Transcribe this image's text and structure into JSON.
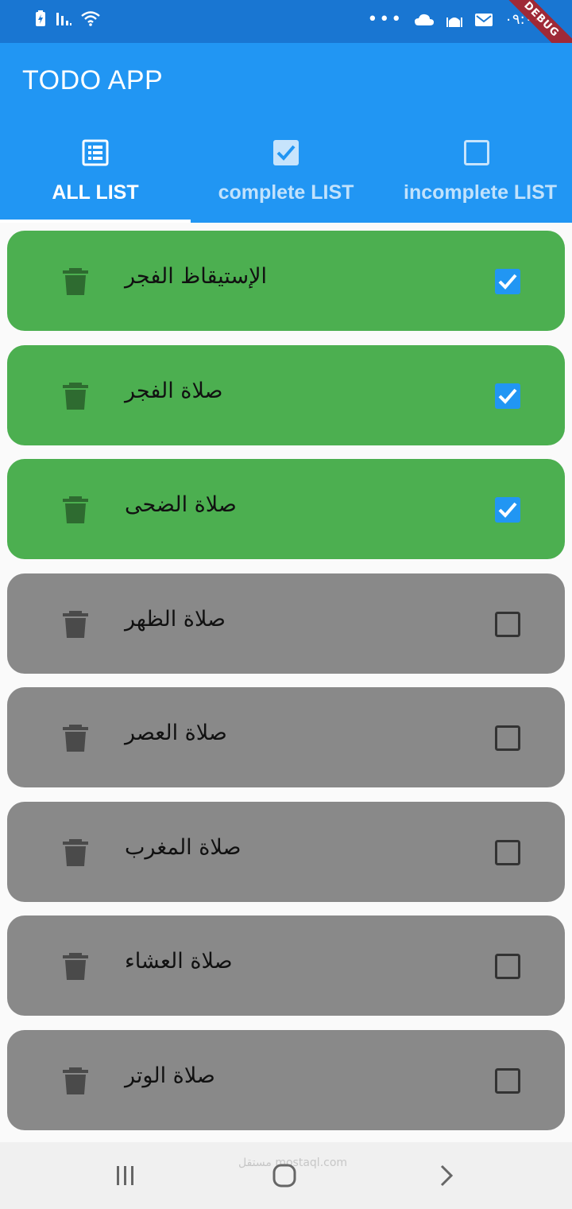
{
  "status_bar": {
    "icons": [
      "battery-icon",
      "signal-icon",
      "wifi-icon",
      "more-dots-icon",
      "cloud-icon",
      "mosque-icon",
      "mail-icon"
    ],
    "time": "٠٩:٠٠",
    "debug_label": "DEBUG"
  },
  "app_bar": {
    "title": "TODO APP",
    "background": "#2196f3"
  },
  "tabs": [
    {
      "label": "ALL LIST",
      "icon": "list-icon",
      "selected": true
    },
    {
      "label": "complete LIST",
      "icon": "checked-box-icon",
      "selected": false
    },
    {
      "label": "incomplete LIST",
      "icon": "empty-box-icon",
      "selected": false
    }
  ],
  "tasks": [
    {
      "title": "الإستيقاظ الفجر",
      "done": true
    },
    {
      "title": "صلاة الفجر",
      "done": true
    },
    {
      "title": "صلاة الضحى",
      "done": true
    },
    {
      "title": "صلاة الظهر",
      "done": false
    },
    {
      "title": "صلاة العصر",
      "done": false
    },
    {
      "title": "صلاة المغرب",
      "done": false
    },
    {
      "title": "صلاة العشاء",
      "done": false
    },
    {
      "title": "صلاة الوتر",
      "done": false
    }
  ],
  "colors": {
    "done_card": "#4caf50",
    "todo_card": "#898989",
    "accent": "#2196f3"
  },
  "nav_bar": {
    "buttons": [
      "recents-icon",
      "home-icon",
      "back-icon"
    ],
    "watermark": "مستقل mostaql.com"
  }
}
